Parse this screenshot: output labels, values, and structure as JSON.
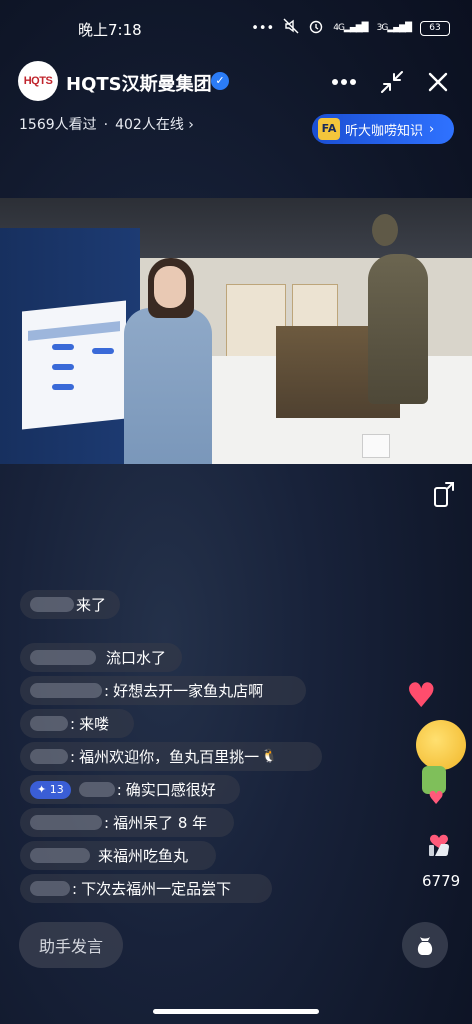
{
  "status_bar": {
    "time": "晚上7:18",
    "icons": [
      "more-dots",
      "mute",
      "alarm",
      "signal-4g",
      "signal-3g"
    ],
    "net1": "4G",
    "net2": "3G",
    "battery": "63"
  },
  "header": {
    "avatar_text": "HQTS",
    "channel_name": "HQTS汉斯曼集团",
    "verified": true
  },
  "stats": {
    "viewers_total": "1569人看过",
    "online": "402人在线",
    "chevron": "›"
  },
  "promo": {
    "label": "听大咖唠知识",
    "chevron": "›"
  },
  "chat": {
    "messages": [
      {
        "text": "来了"
      },
      {
        "text": "流口水了"
      },
      {
        "text": "好想去开一家鱼丸店啊"
      },
      {
        "text": "来喽"
      },
      {
        "text": "福州欢迎你，鱼丸百里挑一"
      },
      {
        "badge": "13",
        "text": "确实口感很好"
      },
      {
        "text": "福州呆了 8 年"
      },
      {
        "text": "来福州吃鱼丸"
      },
      {
        "text": "下次去福州一定品尝下"
      }
    ],
    "colon": ":"
  },
  "likes": {
    "count": "6779"
  },
  "bottom": {
    "helper_label": "助手发言"
  },
  "colors": {
    "accent_blue": "#2f72ff",
    "heart": "#ff4d6d",
    "verified": "#2b7cf6"
  }
}
